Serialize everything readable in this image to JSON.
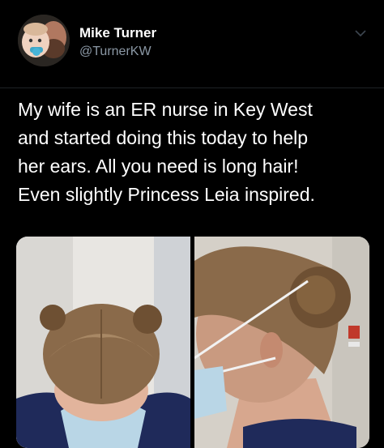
{
  "tweet": {
    "author_name": "Mike Turner",
    "author_handle": "@TurnerKW",
    "text": "My wife is an ER nurse in Key West\nand started doing this today to help\nher ears. All you need is long hair!\nEven slightly Princess Leia inspired.",
    "menu_icon": "chevron-down-icon",
    "avatar_icon": "avatar"
  },
  "colors": {
    "background": "#000000",
    "name_text": "#ffffff",
    "handle_text": "#8b98a5",
    "body_text": "#ffffff"
  }
}
